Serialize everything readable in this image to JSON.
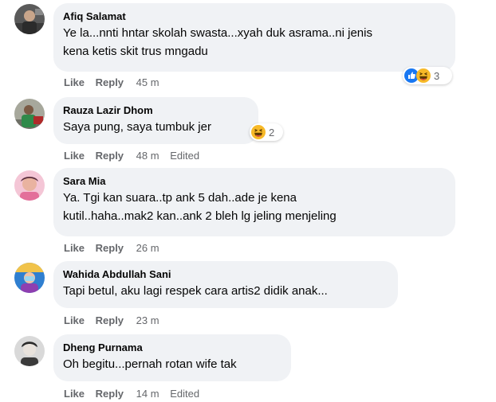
{
  "actions": {
    "like": "Like",
    "reply": "Reply",
    "edited": "Edited"
  },
  "colors": {
    "bubble": "#f0f2f5",
    "text": "#050505",
    "meta": "#65676b",
    "like_blue": "#1877f2",
    "haha_yellow": "#f7b928"
  },
  "comments": [
    {
      "author": "Afiq Salamat",
      "text": "Ye la...nnti hntar skolah swasta...xyah duk asrama..ni jenis\nkena ketis skit trus mngadu",
      "time": "45 m",
      "reaction_icons": [
        "like-icon",
        "haha-icon"
      ],
      "reaction_count": "3"
    },
    {
      "author": "Rauza Lazir Dhom",
      "text": "Saya pung, saya tumbuk jer",
      "time": "48 m",
      "edited": true,
      "reaction_icons": [
        "haha-icon"
      ],
      "reaction_count": "2"
    },
    {
      "author": "Sara Mia",
      "text": "Ya. Tgi kan suara..tp ank 5 dah..ade je kena\nkutil..haha..mak2 kan..ank 2 bleh lg jeling menjeling",
      "time": "26 m"
    },
    {
      "author": "Wahida Abdullah Sani",
      "text": "Tapi betul, aku lagi respek cara artis2 didik anak...",
      "time": "23 m"
    },
    {
      "author": "Dheng Purnama",
      "text": "Oh begitu...pernah rotan wife tak",
      "time": "14 m",
      "edited": true
    }
  ]
}
